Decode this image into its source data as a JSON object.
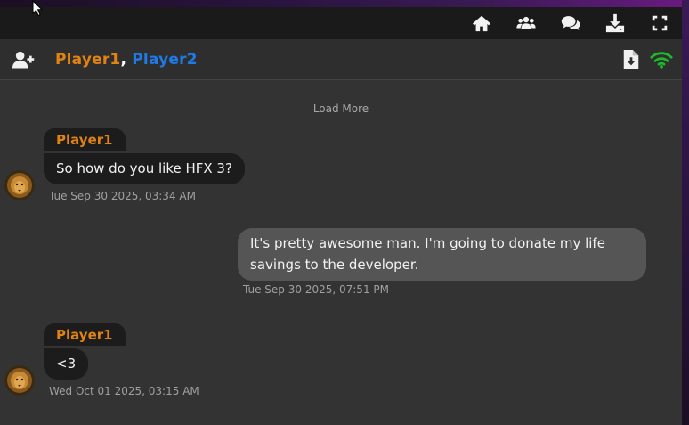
{
  "toolbar": {
    "icons": [
      "home-icon",
      "users-icon",
      "chat-icon",
      "download-icon",
      "fullscreen-icon"
    ]
  },
  "header": {
    "participants": [
      {
        "name": "Player1",
        "color": "#e08214"
      },
      {
        "name": "Player2",
        "color": "#1f7ae6"
      }
    ],
    "separator": ",",
    "icons": [
      "add-user-icon",
      "file-download-icon",
      "wifi-icon"
    ],
    "wifi_color": "#1db92b"
  },
  "chat": {
    "load_more": "Load More",
    "messages": [
      {
        "sender": "Player1",
        "text": "So how do you like HFX 3?",
        "timestamp": "Tue Sep 30 2025, 03:34 AM",
        "side": "left"
      },
      {
        "sender": "",
        "text": "It's pretty awesome man. I'm going to donate my life savings to the developer.",
        "timestamp": "Tue Sep 30 2025, 07:51 PM",
        "side": "right"
      },
      {
        "sender": "Player1",
        "text": "<3",
        "timestamp": "Wed Oct 01 2025, 03:15 AM",
        "side": "left"
      }
    ]
  }
}
